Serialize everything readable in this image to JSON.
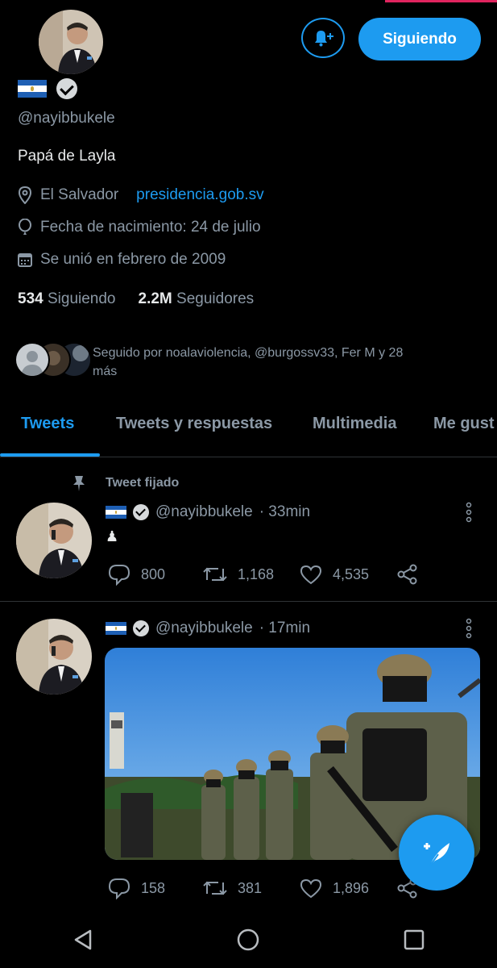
{
  "profile": {
    "handle": "@nayibbukele",
    "bio": "Papá de Layla",
    "location": "El Salvador",
    "website": "presidencia.gob.sv",
    "birthday": "Fecha de nacimiento: 24 de julio",
    "joined": "Se unió en febrero de 2009",
    "following_count": "534",
    "following_label": "Siguiendo",
    "followers_count": "2.2M",
    "followers_label": "Seguidores",
    "followed_by_line1": "Seguido por noalaviolencia, @burgossv33, Fer M y 28",
    "followed_by_line2": "más",
    "follow_button": "Siguiendo"
  },
  "tabs": [
    {
      "label": "Tweets"
    },
    {
      "label": "Tweets y respuestas"
    },
    {
      "label": "Multimedia"
    },
    {
      "label": "Me gust"
    }
  ],
  "tweets": [
    {
      "pinned_label": "Tweet fijado",
      "handle": "@nayibbukele",
      "time": "· 33min",
      "text": "♟",
      "replies": "800",
      "retweets": "1,168",
      "likes": "4,535"
    },
    {
      "handle": "@nayibbukele",
      "time": "· 17min",
      "replies": "158",
      "retweets": "381",
      "likes": "1,896"
    }
  ],
  "colors": {
    "accent": "#1d9bf0",
    "background": "#000000",
    "muted_text": "#8b98a5"
  }
}
